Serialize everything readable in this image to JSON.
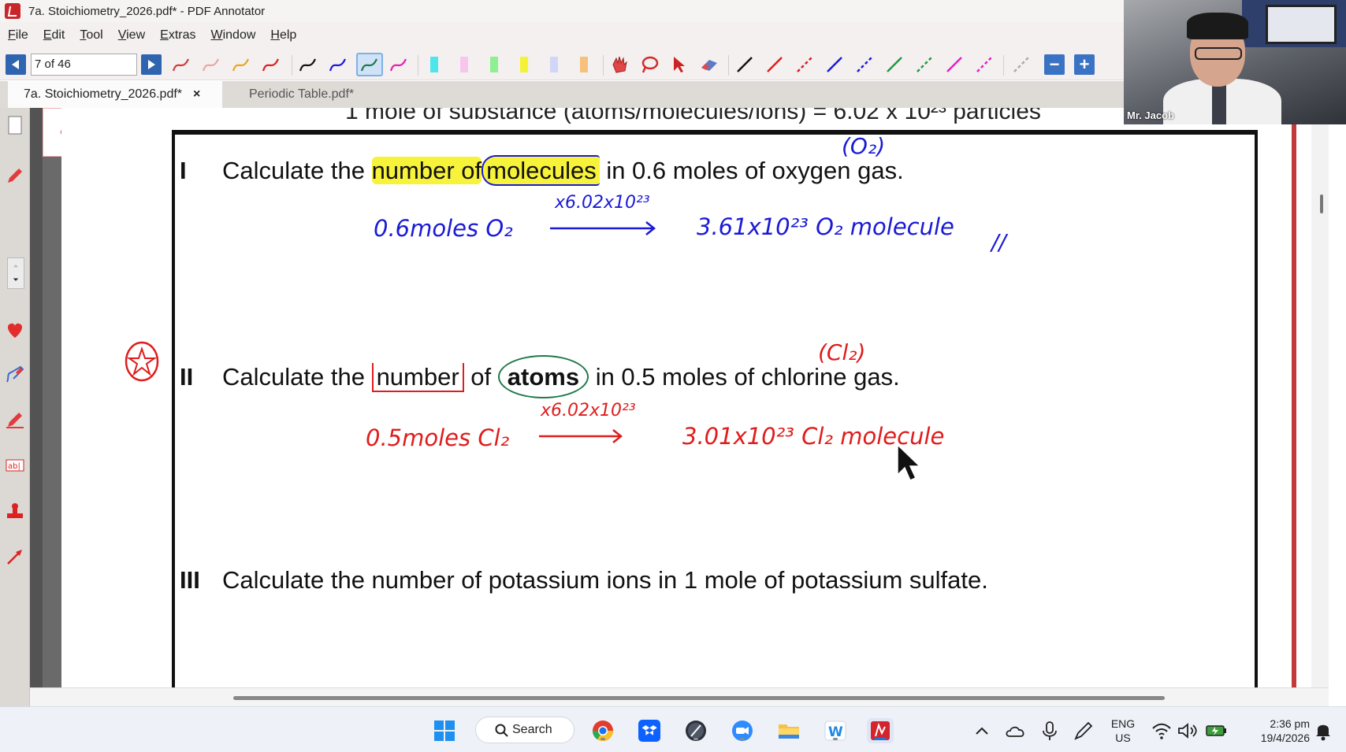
{
  "window": {
    "title": "7a. Stoichiometry_2026.pdf* - PDF Annotator"
  },
  "menu": [
    "File",
    "Edit",
    "Tool",
    "View",
    "Extras",
    "Window",
    "Help"
  ],
  "toolbar": {
    "page_indicator": "7 of 46",
    "zoom_out_label": "−",
    "zoom_in_label": "+"
  },
  "tabs": [
    {
      "label": "7a. Stoichiometry_2026.pdf*",
      "active": true,
      "close": "×"
    },
    {
      "label": "Periodic Table.pdf*",
      "active": false
    }
  ],
  "document": {
    "top_cut_text": "1 mole of substance (atoms/molecules/ions) = 6.02 x 10²³ particles",
    "questions": [
      {
        "num": "I",
        "pre": "Calculate the ",
        "hl": "number of",
        "mid": "molecules",
        "post": " in 0.6 moles of oxygen gas."
      },
      {
        "num": "II",
        "pre": "Calculate the ",
        "hl": "number",
        "of": " of ",
        "bold": "atoms",
        "post": " in 0.5 moles of chlorine gas."
      },
      {
        "num": "III",
        "text": "Calculate the number of potassium ions in 1 mole of potassium sulfate."
      }
    ],
    "handwriting": {
      "q1_formula": "(O₂)",
      "q1_left": "0.6moles O₂",
      "q1_arrow_label": "x6.02x10²³",
      "q1_right": "3.61x10²³  O₂ molecule",
      "q1_end_mark": "//",
      "q2_formula": "(Cl₂)",
      "q2_left": "0.5moles Cl₂",
      "q2_arrow_label": "x6.02x10²³",
      "q2_right": "3.01x10²³  Cl₂ molecule"
    }
  },
  "webcam": {
    "name": "Mr. Jacob"
  },
  "taskbar": {
    "search_label": "Search",
    "language": "ENG",
    "region": "US",
    "time": "2:36 pm",
    "date": "19/4/2026"
  },
  "colors": {
    "pen_blue": "#1a1ad6",
    "pen_red": "#e01c1c",
    "pen_green": "#1f7a4a",
    "highlight_yellow": "#f7f23a",
    "nav_blue": "#2f64b0"
  }
}
